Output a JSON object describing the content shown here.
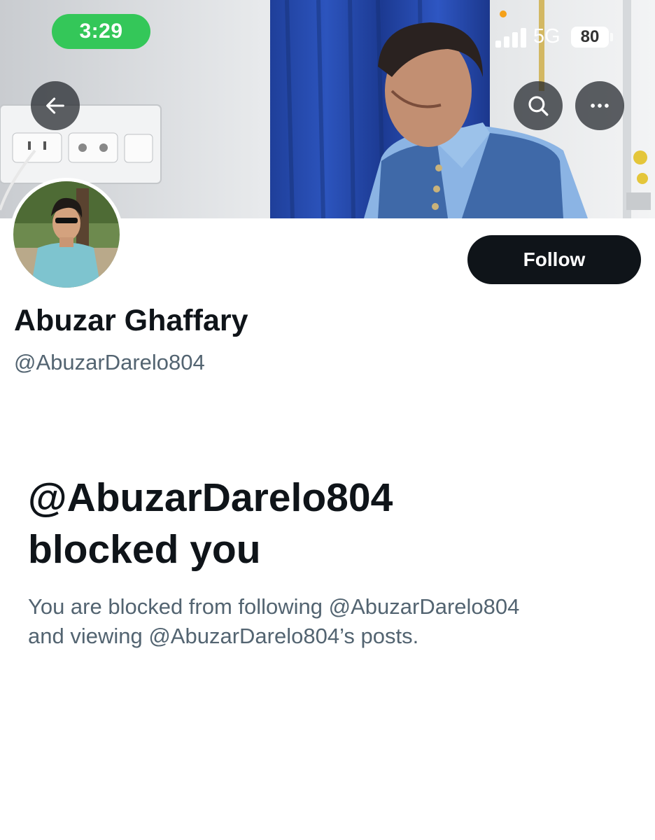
{
  "status_bar": {
    "time": "3:29",
    "network": "5G",
    "battery": "80",
    "accent_color": "#34c759"
  },
  "header": {
    "back_icon": "arrow-left-icon",
    "search_icon": "search-icon",
    "more_icon": "more-horizontal-icon"
  },
  "profile": {
    "display_name": "Abuzar Ghaffary",
    "handle": "@AbuzarDarelo804",
    "follow_label": "Follow"
  },
  "blocked": {
    "title_line1": "@AbuzarDarelo804",
    "title_line2": "blocked you",
    "description_line1": "You are blocked from following @AbuzarDarelo804",
    "description_line2": "and viewing @AbuzarDarelo804’s posts."
  },
  "colors": {
    "primary_text": "#0f1419",
    "secondary_text": "#536471",
    "follow_button_bg": "#0f1419"
  }
}
